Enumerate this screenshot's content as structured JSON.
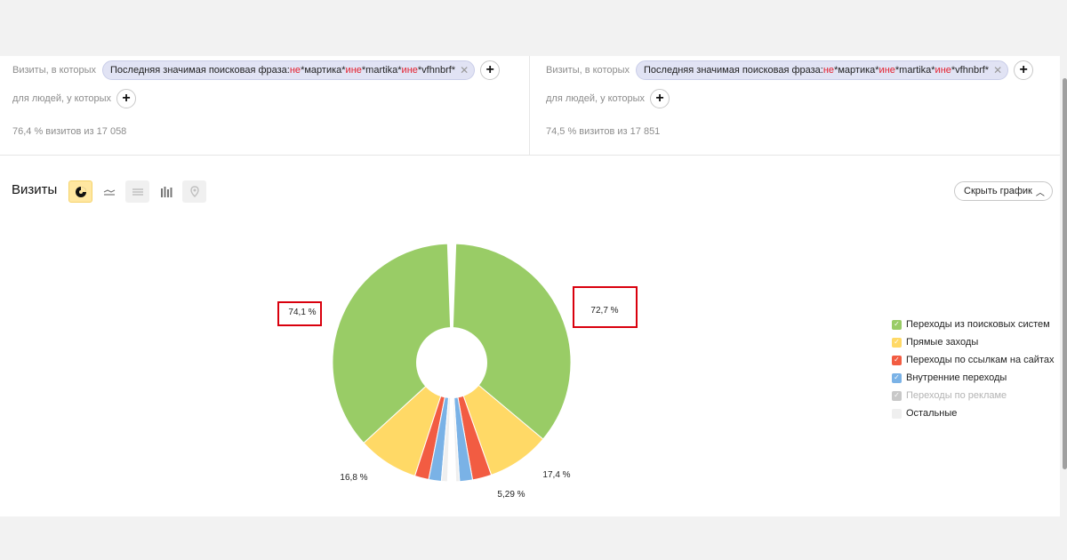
{
  "segments": [
    {
      "visits_label": "Визиты, в которых",
      "filter": {
        "prefix": "Последняя значимая поисковая фраза: ",
        "neg1": "не",
        "term1": " *мартика* ",
        "and1": "и",
        "neg2": " не",
        "term2": " *martika* ",
        "and2": "и",
        "neg3": " не",
        "term3": " *vfhnbrf*"
      },
      "people_label": "для людей, у которых",
      "stat": "76,4 % визитов из 17 058"
    },
    {
      "visits_label": "Визиты, в которых",
      "filter": {
        "prefix": "Последняя значимая поисковая фраза: ",
        "neg1": "не",
        "term1": " *мартика* ",
        "and1": "и",
        "neg2": " не",
        "term2": " *martika* ",
        "and2": "и",
        "neg3": " не",
        "term3": " *vfhnbrf*"
      },
      "people_label": "для людей, у которых",
      "stat": "74,5 % визитов из 17 851"
    }
  ],
  "chart_header": {
    "title": "Визиты",
    "hide_label": "Скрыть график"
  },
  "icons": {
    "close": "close-icon",
    "add": "plus-icon",
    "pie": "pie-chart-icon",
    "line": "line-chart-icon",
    "area": "area-chart-icon",
    "bar": "bar-chart-icon",
    "map": "map-icon",
    "chevron": "chevron-up-icon"
  },
  "colors": {
    "highlight": "#d9000d"
  },
  "chart_data": {
    "type": "pie",
    "categories": [
      "Переходы из поисковых систем",
      "Прямые заходы",
      "Переходы по ссылкам на сайтах",
      "Внутренние переходы",
      "Переходы по рекламе",
      "Остальные"
    ],
    "colors": [
      "#99cc66",
      "#ffd966",
      "#f25c42",
      "#7ab2e6",
      "#c8c8c8",
      "#efefef"
    ],
    "disabled": [
      false,
      false,
      false,
      false,
      true,
      false
    ],
    "series": [
      {
        "values": [
          74.1,
          16.8,
          3.9,
          3.5,
          0,
          1.7
        ]
      },
      {
        "values": [
          72.7,
          17.4,
          5.29,
          3.6,
          0,
          1.01
        ]
      }
    ],
    "labels": {
      "left_main": "74,1 %",
      "left_secondary": "16,8 %",
      "right_main": "72,7 %",
      "right_secondary": "17,4 %",
      "right_tertiary": "5,29 %"
    },
    "legend_placement": "right"
  }
}
